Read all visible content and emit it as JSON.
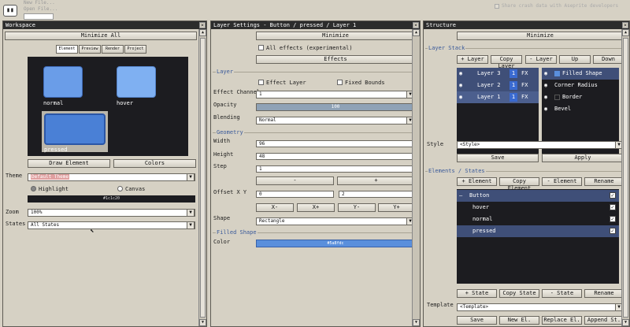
{
  "top": {
    "menu1": "New File...",
    "menu2": "Open File...",
    "crash": "Share crash data with Aseprite developers"
  },
  "workspace": {
    "title": "Workspace",
    "minimize": "Minimize All",
    "tabs": [
      "Element",
      "Preview",
      "Render",
      "Project"
    ],
    "states": [
      "normal",
      "hover",
      "pressed"
    ],
    "draw_element": "Draw Element",
    "colors": "Colors",
    "theme_label": "Theme",
    "theme_value": "Default Theme",
    "highlight": "Highlight",
    "canvas": "Canvas",
    "color_value": "#1c1c20",
    "zoom_label": "Zoom",
    "zoom_value": "100%",
    "states_label": "States",
    "states_value": "All States"
  },
  "layer": {
    "title": "Layer Settings - Button / pressed / Layer 1",
    "minimize": "Minimize",
    "all_effects": "All effects (experimental)",
    "effects": "Effects",
    "layer_sec": "Layer",
    "effect_layer": "Effect Layer",
    "fixed_bounds": "Fixed Bounds",
    "effect_channel": "Effect Channel",
    "channel_value": "1",
    "opacity": "Opacity",
    "opacity_value": "100",
    "opacity_fill": 1.0,
    "blending": "Blending",
    "blending_value": "Normal",
    "geometry": "Geometry",
    "width": "Width",
    "width_value": "96",
    "height": "Height",
    "height_value": "48",
    "step": "Step",
    "step_value": "1",
    "minus": "-",
    "plus": "+",
    "offset": "Offset X Y",
    "offset_x": "0",
    "offset_y": "2",
    "xm": "X-",
    "xp": "X+",
    "ym": "Y-",
    "yp": "Y+",
    "shape": "Shape",
    "shape_value": "Rectangle",
    "filled_shape": "Filled Shape",
    "color": "Color",
    "color_value": "#5a8fdc"
  },
  "structure": {
    "title": "Structure",
    "minimize": "Minimize",
    "layer_stack": "Layer Stack",
    "add_layer": "+ Layer",
    "copy_layer": "Copy Layer",
    "remove_layer": "- Layer",
    "up": "Up",
    "down": "Down",
    "layers": [
      {
        "name": "Layer 3",
        "num": "1",
        "fx": "FX"
      },
      {
        "name": "Layer 2",
        "num": "1",
        "fx": "FX"
      },
      {
        "name": "Layer 1",
        "num": "1",
        "fx": "FX"
      }
    ],
    "effects": [
      "Filled Shape",
      "Corner Radius",
      "Border",
      "Bevel"
    ],
    "style_label": "Style",
    "style_value": "<Style>",
    "save": "Save",
    "apply": "Apply",
    "elements_states": "Elements / States",
    "add_element": "+ Element",
    "copy_element": "Copy Element",
    "remove_element": "- Element",
    "rename": "Rename",
    "tree": [
      "Button",
      "hover",
      "normal",
      "pressed"
    ],
    "add_state": "+ State",
    "copy_state": "Copy State",
    "remove_state": "- State",
    "rename2": "Rename",
    "template_label": "Template",
    "template_value": "<Template>",
    "save2": "Save",
    "new_el": "New El.",
    "replace_el": "Replace El.",
    "append_st": "Append St."
  },
  "colors": {
    "blue": "#5a8fdc",
    "titlebar": "#2c2c2c",
    "dark": "#1c1c20",
    "select": "#3f4f78"
  }
}
